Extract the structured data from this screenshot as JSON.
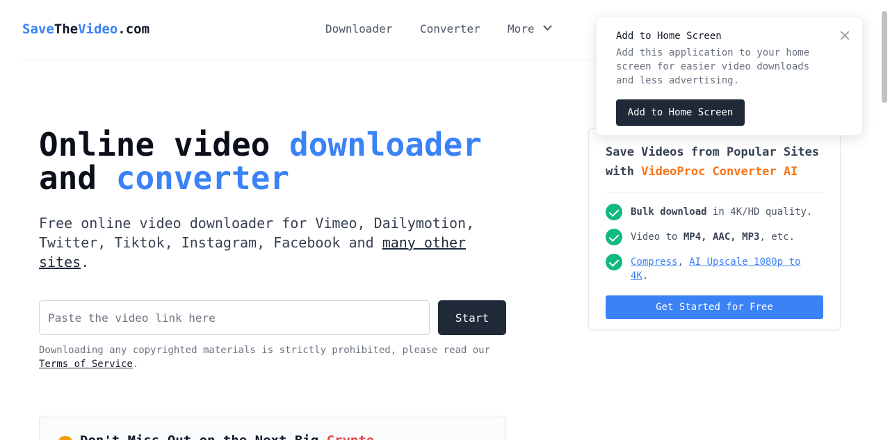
{
  "header": {
    "logo": {
      "part1": "Save",
      "part2": "The",
      "part3": "Video",
      "part4": ".com"
    },
    "nav": {
      "downloader": "Downloader",
      "converter": "Converter",
      "more": "More"
    }
  },
  "hero": {
    "title_line1_plain": "Online video ",
    "title_line1_accent": "downloader",
    "title_line2_plain": "and ",
    "title_line2_accent": "converter",
    "subtitle": "Free online video downloader for Vimeo, Dailymotion, Twitter, Tiktok, Instagram, Facebook and ",
    "subtitle_link": "many other sites",
    "subtitle_end": "."
  },
  "search": {
    "placeholder": "Paste the video link here",
    "value": "",
    "button": "Start"
  },
  "disclaimer": {
    "text": "Downloading any copyrighted materials is strictly prohibited, please read our ",
    "link": "Terms of Service",
    "end": "."
  },
  "crypto": {
    "text": "Don't Miss Out on the Next Big ",
    "accent": "Crypto"
  },
  "side_card": {
    "title_plain": "Save Videos from Popular Sites with ",
    "title_accent": "VideoProc Converter AI",
    "features": [
      {
        "bold": "Bulk download",
        "rest": " in 4K/HD quality."
      },
      {
        "pre": "Video to ",
        "bold": "MP4, AAC, MP3",
        "rest": ", etc."
      },
      {
        "link1": "Compress",
        "sep": ", ",
        "link2": "AI Upscale 1080p to 4K",
        "end": "."
      }
    ],
    "button": "Get Started for Free"
  },
  "popup": {
    "title": "Add to Home Screen",
    "body": "Add this application to your home screen for easier video downloads and less advertising.",
    "button": "Add to Home Screen"
  },
  "colors": {
    "accent": "#3b82f6",
    "dark": "#1f2937",
    "orange": "#f97316",
    "check": "#10b981"
  },
  "icons": {
    "more": "chevron-down-icon",
    "close": "close-icon",
    "check": "check-circle-icon",
    "crypto": "coin-icon"
  }
}
